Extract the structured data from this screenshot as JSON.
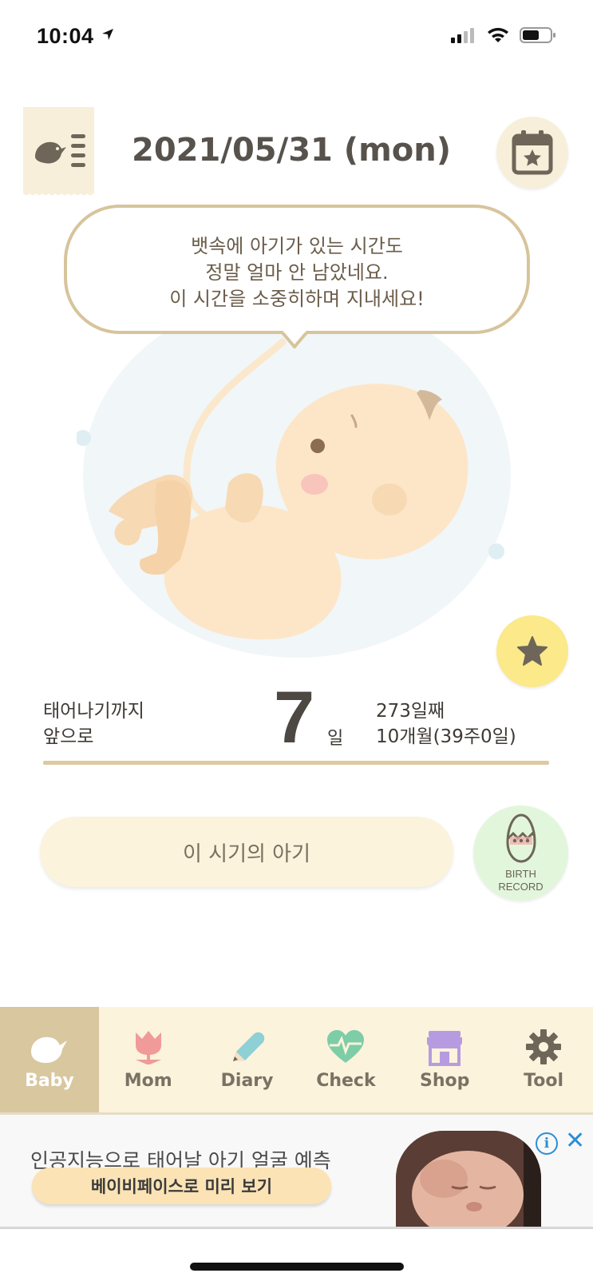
{
  "status_bar": {
    "time": "10:04",
    "location_icon": "location-arrow-icon",
    "signal_icon": "cellular-signal-icon",
    "wifi_icon": "wifi-icon",
    "battery_icon": "battery-icon"
  },
  "header": {
    "date": "2021/05/31 (mon)",
    "menu_icon": "bird-menu-icon",
    "calendar_icon": "calendar-star-icon"
  },
  "bubble": {
    "line1": "뱃속에 아기가 있는 시간도",
    "line2": "정말 얼마 안 남았네요.",
    "line3": "이 시간을 소중히하며 지내세요!"
  },
  "countdown": {
    "label_line1": "태어나기까지",
    "label_line2": "앞으로",
    "days_left": "7",
    "unit": "일",
    "day_count": "273일째",
    "month_week": "10개월(39주0일)"
  },
  "period_button": {
    "label": "이 시기의 아기"
  },
  "birth_record": {
    "line1": "BIRTH",
    "line2": "RECORD",
    "icon": "egg-icon"
  },
  "tabs": [
    {
      "label": "Baby",
      "icon": "bird-icon",
      "active": true
    },
    {
      "label": "Mom",
      "icon": "tulip-icon",
      "active": false
    },
    {
      "label": "Diary",
      "icon": "pencil-icon",
      "active": false
    },
    {
      "label": "Check",
      "icon": "heart-pulse-icon",
      "active": false
    },
    {
      "label": "Shop",
      "icon": "store-icon",
      "active": false
    },
    {
      "label": "Tool",
      "icon": "gear-icon",
      "active": false
    }
  ],
  "ad": {
    "headline": "인공지능으로 태어날 아기 얼굴 예측",
    "cta": "베이비페이스로 미리 보기",
    "info": "i",
    "close": "✕"
  },
  "colors": {
    "accent": "#d9c7a0",
    "cream": "#fbf3dc",
    "bubble_border": "#d7c49b",
    "star_bg": "#fbe98a",
    "birth_bg": "#e2f6dc"
  }
}
